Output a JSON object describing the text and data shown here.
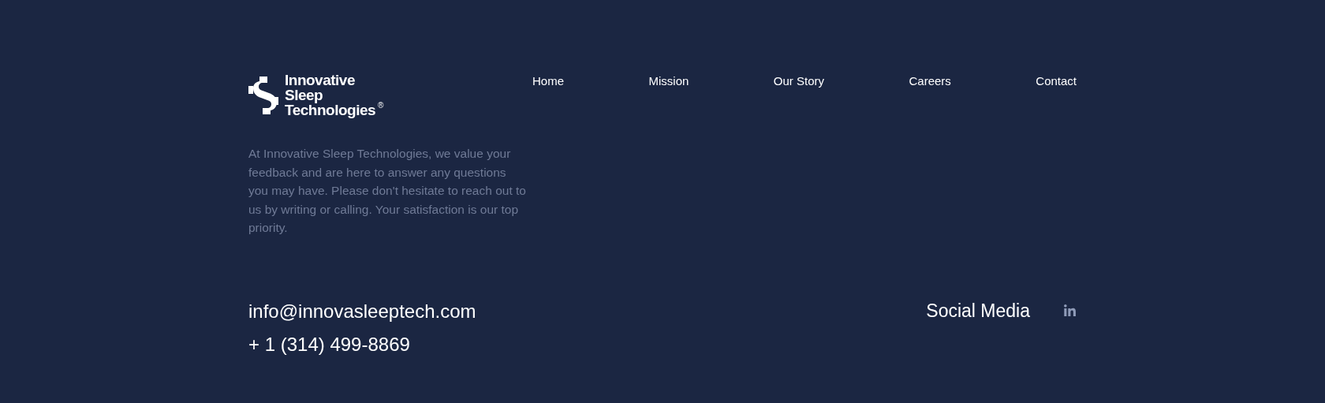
{
  "logo": {
    "lines": [
      "Innovative",
      "Sleep",
      "Technologies"
    ],
    "mark": "®"
  },
  "nav": [
    {
      "label": "Home"
    },
    {
      "label": "Mission"
    },
    {
      "label": "Our Story"
    },
    {
      "label": "Careers"
    },
    {
      "label": "Contact"
    }
  ],
  "description": "At Innovative Sleep Technologies, we value your feedback and are here to answer any questions you may have. Please don't hesitate to reach out to us by writing or calling. Your satisfaction is our top priority.",
  "contact": {
    "email": "info@innovasleeptech.com",
    "phone": "+ 1 (314) 499-8869"
  },
  "social": {
    "heading": "Social Media",
    "links": [
      {
        "kind": "linkedin"
      }
    ]
  }
}
